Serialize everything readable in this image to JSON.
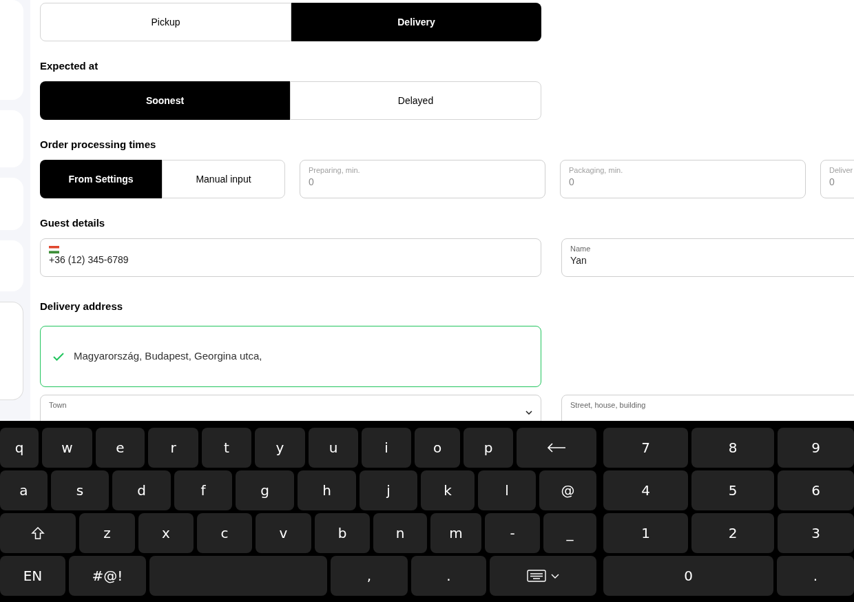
{
  "order_type": {
    "options": [
      {
        "label": "Pickup",
        "selected": false
      },
      {
        "label": "Delivery",
        "selected": true
      }
    ]
  },
  "expected_at": {
    "title": "Expected at",
    "options": [
      {
        "label": "Soonest",
        "selected": true
      },
      {
        "label": "Delayed",
        "selected": false
      }
    ]
  },
  "processing": {
    "title": "Order processing times",
    "options": [
      {
        "label": "From Settings",
        "selected": true
      },
      {
        "label": "Manual input",
        "selected": false
      }
    ],
    "fields": [
      {
        "label": "Preparing, min.",
        "value": "0"
      },
      {
        "label": "Packaging, min.",
        "value": "0"
      },
      {
        "label": "Deliver",
        "value": "0"
      }
    ]
  },
  "guest": {
    "title": "Guest details",
    "phone": "+36 (12) 345-6789",
    "name": {
      "label": "Name",
      "value": "Yan"
    }
  },
  "address": {
    "title": "Delivery address",
    "suggestion": {
      "text": "Magyarország, Budapest, Georgina utca,",
      "confirmed": true
    },
    "town": {
      "label": "Town"
    },
    "street": {
      "label": "Street, house, building"
    }
  },
  "keyboard": {
    "letters": [
      [
        {
          "kind": "char",
          "label": "q"
        },
        {
          "kind": "char",
          "label": "w"
        },
        {
          "kind": "char",
          "label": "e"
        },
        {
          "kind": "char",
          "label": "r"
        },
        {
          "kind": "char",
          "label": "t"
        },
        {
          "kind": "char",
          "label": "y"
        },
        {
          "kind": "char",
          "label": "u"
        },
        {
          "kind": "char",
          "label": "i"
        },
        {
          "kind": "char",
          "label": "o"
        },
        {
          "kind": "char",
          "label": "p"
        },
        {
          "kind": "backspace"
        }
      ],
      [
        {
          "kind": "char",
          "label": "a"
        },
        {
          "kind": "char",
          "label": "s"
        },
        {
          "kind": "char",
          "label": "d"
        },
        {
          "kind": "char",
          "label": "f"
        },
        {
          "kind": "char",
          "label": "g"
        },
        {
          "kind": "char",
          "label": "h"
        },
        {
          "kind": "char",
          "label": "j"
        },
        {
          "kind": "char",
          "label": "k"
        },
        {
          "kind": "char",
          "label": "l"
        },
        {
          "kind": "char",
          "label": "@"
        }
      ],
      [
        {
          "kind": "shift"
        },
        {
          "kind": "char",
          "label": "z"
        },
        {
          "kind": "char",
          "label": "x"
        },
        {
          "kind": "char",
          "label": "c"
        },
        {
          "kind": "char",
          "label": "v"
        },
        {
          "kind": "char",
          "label": "b"
        },
        {
          "kind": "char",
          "label": "n"
        },
        {
          "kind": "char",
          "label": "m"
        },
        {
          "kind": "char",
          "label": "-"
        },
        {
          "kind": "char",
          "label": "_"
        }
      ],
      [
        {
          "kind": "char",
          "label": "EN"
        },
        {
          "kind": "char",
          "label": "#@!"
        },
        {
          "kind": "space"
        },
        {
          "kind": "char",
          "label": ","
        },
        {
          "kind": "char",
          "label": "."
        },
        {
          "kind": "hide"
        }
      ]
    ],
    "numbers": [
      [
        {
          "kind": "char",
          "label": "7"
        },
        {
          "kind": "char",
          "label": "8"
        },
        {
          "kind": "char",
          "label": "9"
        }
      ],
      [
        {
          "kind": "char",
          "label": "4"
        },
        {
          "kind": "char",
          "label": "5"
        },
        {
          "kind": "char",
          "label": "6"
        }
      ],
      [
        {
          "kind": "char",
          "label": "1"
        },
        {
          "kind": "char",
          "label": "2"
        },
        {
          "kind": "char",
          "label": "3"
        }
      ],
      [
        {
          "kind": "char",
          "label": "0"
        },
        {
          "kind": "char",
          "label": "."
        }
      ]
    ]
  }
}
